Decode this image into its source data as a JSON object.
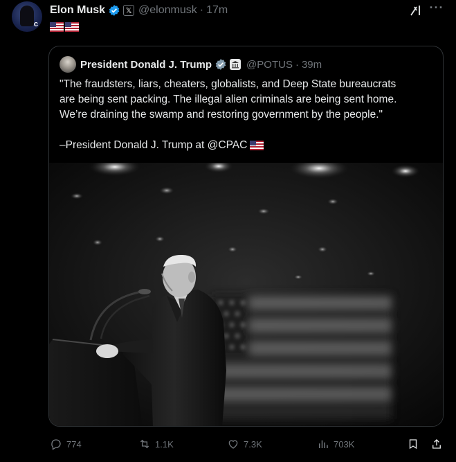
{
  "post": {
    "author_name": "Elon Musk",
    "author_handle": "@elonmusk",
    "time": "17m",
    "separator": "·",
    "flags": [
      "us-flag",
      "us-flag"
    ]
  },
  "quote": {
    "author_name": "President Donald J. Trump",
    "author_handle": "@POTUS",
    "time": "39m",
    "separator": "·",
    "text_lines": [
      "\"The fraudsters, liars, cheaters, globalists, and Deep State bureaucrats",
      "are being sent packing. The illegal alien criminals are being sent home.",
      "We’re draining the swamp and restoring government by the people.\""
    ],
    "attribution": "–President Donald J. Trump at @CPAC"
  },
  "actions": {
    "replies": "774",
    "reposts": "1.1K",
    "likes": "7.3K",
    "views": "703K"
  },
  "colors": {
    "background": "#000000",
    "text": "#e7e9ea",
    "muted": "#71767b",
    "border": "#2f3336",
    "verified": "#1d9bf0"
  },
  "icons": [
    "verified-icon",
    "x-affiliate-badge-icon",
    "grok-icon",
    "more-icon",
    "government-badge-icon",
    "reply-icon",
    "repost-icon",
    "like-icon",
    "views-icon",
    "bookmark-icon",
    "share-icon"
  ]
}
